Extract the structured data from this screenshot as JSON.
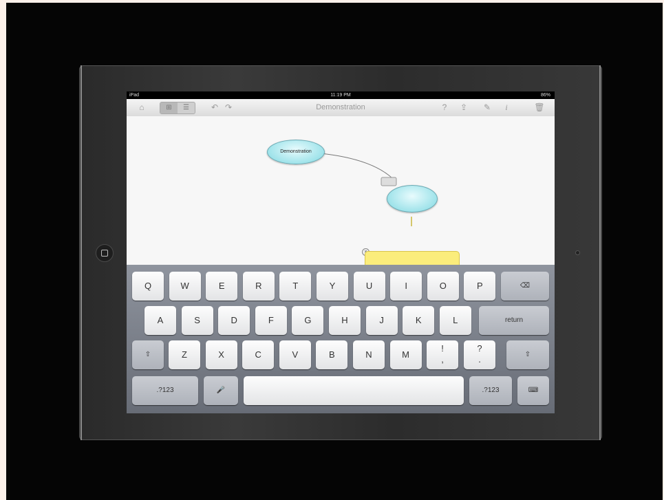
{
  "status": {
    "device": "iPad",
    "time": "11:19 PM",
    "battery": "86%"
  },
  "toolbar": {
    "title": "Demonstration",
    "icons": [
      "home-icon",
      "map-view-icon",
      "outline-view-icon",
      "undo-icon",
      "redo-icon",
      "help-icon",
      "share-icon",
      "edit-icon",
      "info-icon",
      "trash-icon"
    ],
    "glyphs": {
      "home": "⌂",
      "map": "⊞",
      "outline": "☰",
      "undo": "↶",
      "redo": "↷",
      "help": "?",
      "share": "⇪",
      "edit": "✎",
      "info": "i",
      "trash": "🗑"
    }
  },
  "mindmap": {
    "root_label": "Demonstration",
    "child_label": "",
    "note_text": "|",
    "colors": {
      "node": "#9fe3ea",
      "note": "#fbed7c"
    }
  },
  "keyboard": {
    "row1": [
      "Q",
      "W",
      "E",
      "R",
      "T",
      "Y",
      "U",
      "I",
      "O",
      "P"
    ],
    "backspace": "⌫",
    "row2": [
      "A",
      "S",
      "D",
      "F",
      "G",
      "H",
      "J",
      "K",
      "L"
    ],
    "return": "return",
    "shift": "⇧",
    "row3": [
      "Z",
      "X",
      "C",
      "V",
      "B",
      "N",
      "M"
    ],
    "punct1": "!\n,",
    "punct2": "?\n.",
    "numbers": ".?123",
    "mic": "🎤",
    "hide": "⌨"
  }
}
